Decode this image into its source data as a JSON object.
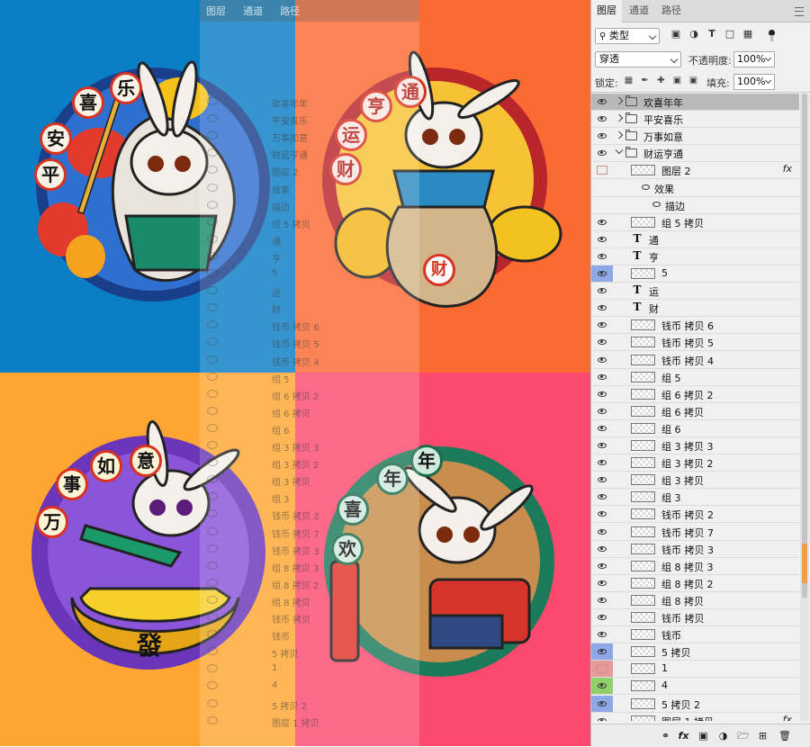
{
  "panel": {
    "tabs": [
      {
        "label": "图层",
        "active": true
      },
      {
        "label": "通道",
        "active": false
      },
      {
        "label": "路径",
        "active": false
      }
    ],
    "filter_kind": "类型",
    "blend_mode": "穿透",
    "opacity_label": "不透明度:",
    "opacity_value": "100%",
    "lock_label": "锁定:",
    "fill_label": "填充:",
    "fill_value": "100%",
    "layers": [
      {
        "name": "欢喜年年",
        "kind": "folder",
        "indent": 0,
        "expanded": false,
        "selected": true,
        "visible": true
      },
      {
        "name": "平安喜乐",
        "kind": "folder",
        "indent": 0,
        "expanded": false,
        "visible": true
      },
      {
        "name": "万事如意",
        "kind": "folder",
        "indent": 0,
        "expanded": false,
        "visible": true
      },
      {
        "name": "财运亨通",
        "kind": "folder",
        "indent": 0,
        "expanded": true,
        "visible": true
      },
      {
        "name": "图层 2",
        "kind": "pixel",
        "indent": 1,
        "fx": true,
        "visible": false
      },
      {
        "name": "效果",
        "kind": "effect",
        "indent": 2,
        "visible": false
      },
      {
        "name": "描边",
        "kind": "effect",
        "indent": 3,
        "visible": false
      },
      {
        "name": "组 5 拷贝",
        "kind": "pixel",
        "indent": 1,
        "visible": true
      },
      {
        "name": "通",
        "kind": "text",
        "indent": 1,
        "visible": true
      },
      {
        "name": "亨",
        "kind": "text",
        "indent": 1,
        "visible": true
      },
      {
        "name": "5",
        "kind": "pixel",
        "indent": 1,
        "visible": true,
        "highlight": "blue"
      },
      {
        "name": "运",
        "kind": "text",
        "indent": 1,
        "visible": true
      },
      {
        "name": "财",
        "kind": "text",
        "indent": 1,
        "visible": true
      },
      {
        "name": "钱币 拷贝 6",
        "kind": "pixel",
        "indent": 1,
        "visible": true
      },
      {
        "name": "钱币 拷贝 5",
        "kind": "pixel",
        "indent": 1,
        "visible": true
      },
      {
        "name": "钱币 拷贝 4",
        "kind": "pixel",
        "indent": 1,
        "visible": true
      },
      {
        "name": "组 5",
        "kind": "pixel",
        "indent": 1,
        "visible": true
      },
      {
        "name": "组 6 拷贝 2",
        "kind": "pixel",
        "indent": 1,
        "visible": true
      },
      {
        "name": "组 6 拷贝",
        "kind": "pixel",
        "indent": 1,
        "visible": true
      },
      {
        "name": "组 6",
        "kind": "pixel",
        "indent": 1,
        "visible": true
      },
      {
        "name": "组 3 拷贝 3",
        "kind": "pixel",
        "indent": 1,
        "visible": true
      },
      {
        "name": "组 3 拷贝 2",
        "kind": "pixel",
        "indent": 1,
        "visible": true
      },
      {
        "name": "组 3 拷贝",
        "kind": "pixel",
        "indent": 1,
        "visible": true
      },
      {
        "name": "组 3",
        "kind": "pixel",
        "indent": 1,
        "visible": true
      },
      {
        "name": "钱币 拷贝 2",
        "kind": "pixel",
        "indent": 1,
        "visible": true
      },
      {
        "name": "钱币 拷贝 7",
        "kind": "pixel",
        "indent": 1,
        "visible": true
      },
      {
        "name": "钱币 拷贝 3",
        "kind": "pixel",
        "indent": 1,
        "visible": true
      },
      {
        "name": "组 8 拷贝 3",
        "kind": "pixel",
        "indent": 1,
        "visible": true
      },
      {
        "name": "组 8 拷贝 2",
        "kind": "pixel",
        "indent": 1,
        "visible": true
      },
      {
        "name": "组 8 拷贝",
        "kind": "pixel",
        "indent": 1,
        "visible": true
      },
      {
        "name": "钱币 拷贝",
        "kind": "pixel",
        "indent": 1,
        "visible": true
      },
      {
        "name": "钱币",
        "kind": "pixel",
        "indent": 1,
        "visible": true
      },
      {
        "name": "5 拷贝",
        "kind": "pixel",
        "indent": 1,
        "visible": true,
        "highlight": "blue"
      },
      {
        "name": "1",
        "kind": "pixel",
        "indent": 1,
        "visible": false,
        "highlight": "red"
      },
      {
        "name": "4",
        "kind": "pixel",
        "indent": 1,
        "visible": true,
        "highlight": "green"
      },
      {
        "name": "5 拷贝 2",
        "kind": "pixel",
        "indent": 1,
        "visible": true,
        "highlight": "blue"
      },
      {
        "name": "图层 1 拷贝",
        "kind": "pixel",
        "indent": 1,
        "fx": true,
        "visible": true
      }
    ],
    "bottom_icons": [
      "link-icon",
      "fx-icon",
      "mask-icon",
      "adjustment-icon",
      "new-group-icon",
      "new-layer-icon",
      "trash-icon"
    ]
  },
  "artwork": {
    "backgrounds": {
      "top_left": "#0a7ec4",
      "top_right": "#fa6a32",
      "bottom_left": "#ffa632",
      "bottom_right": "#fb4a6e"
    },
    "q1_text": [
      "平",
      "安",
      "喜",
      "乐"
    ],
    "q2_text": [
      "财",
      "运",
      "亨",
      "通"
    ],
    "q2_bag": "财",
    "q3_text": [
      "万",
      "事",
      "如",
      "意"
    ],
    "q3_ingot": "發",
    "q4_text": [
      "欢",
      "喜",
      "年",
      "年"
    ]
  }
}
